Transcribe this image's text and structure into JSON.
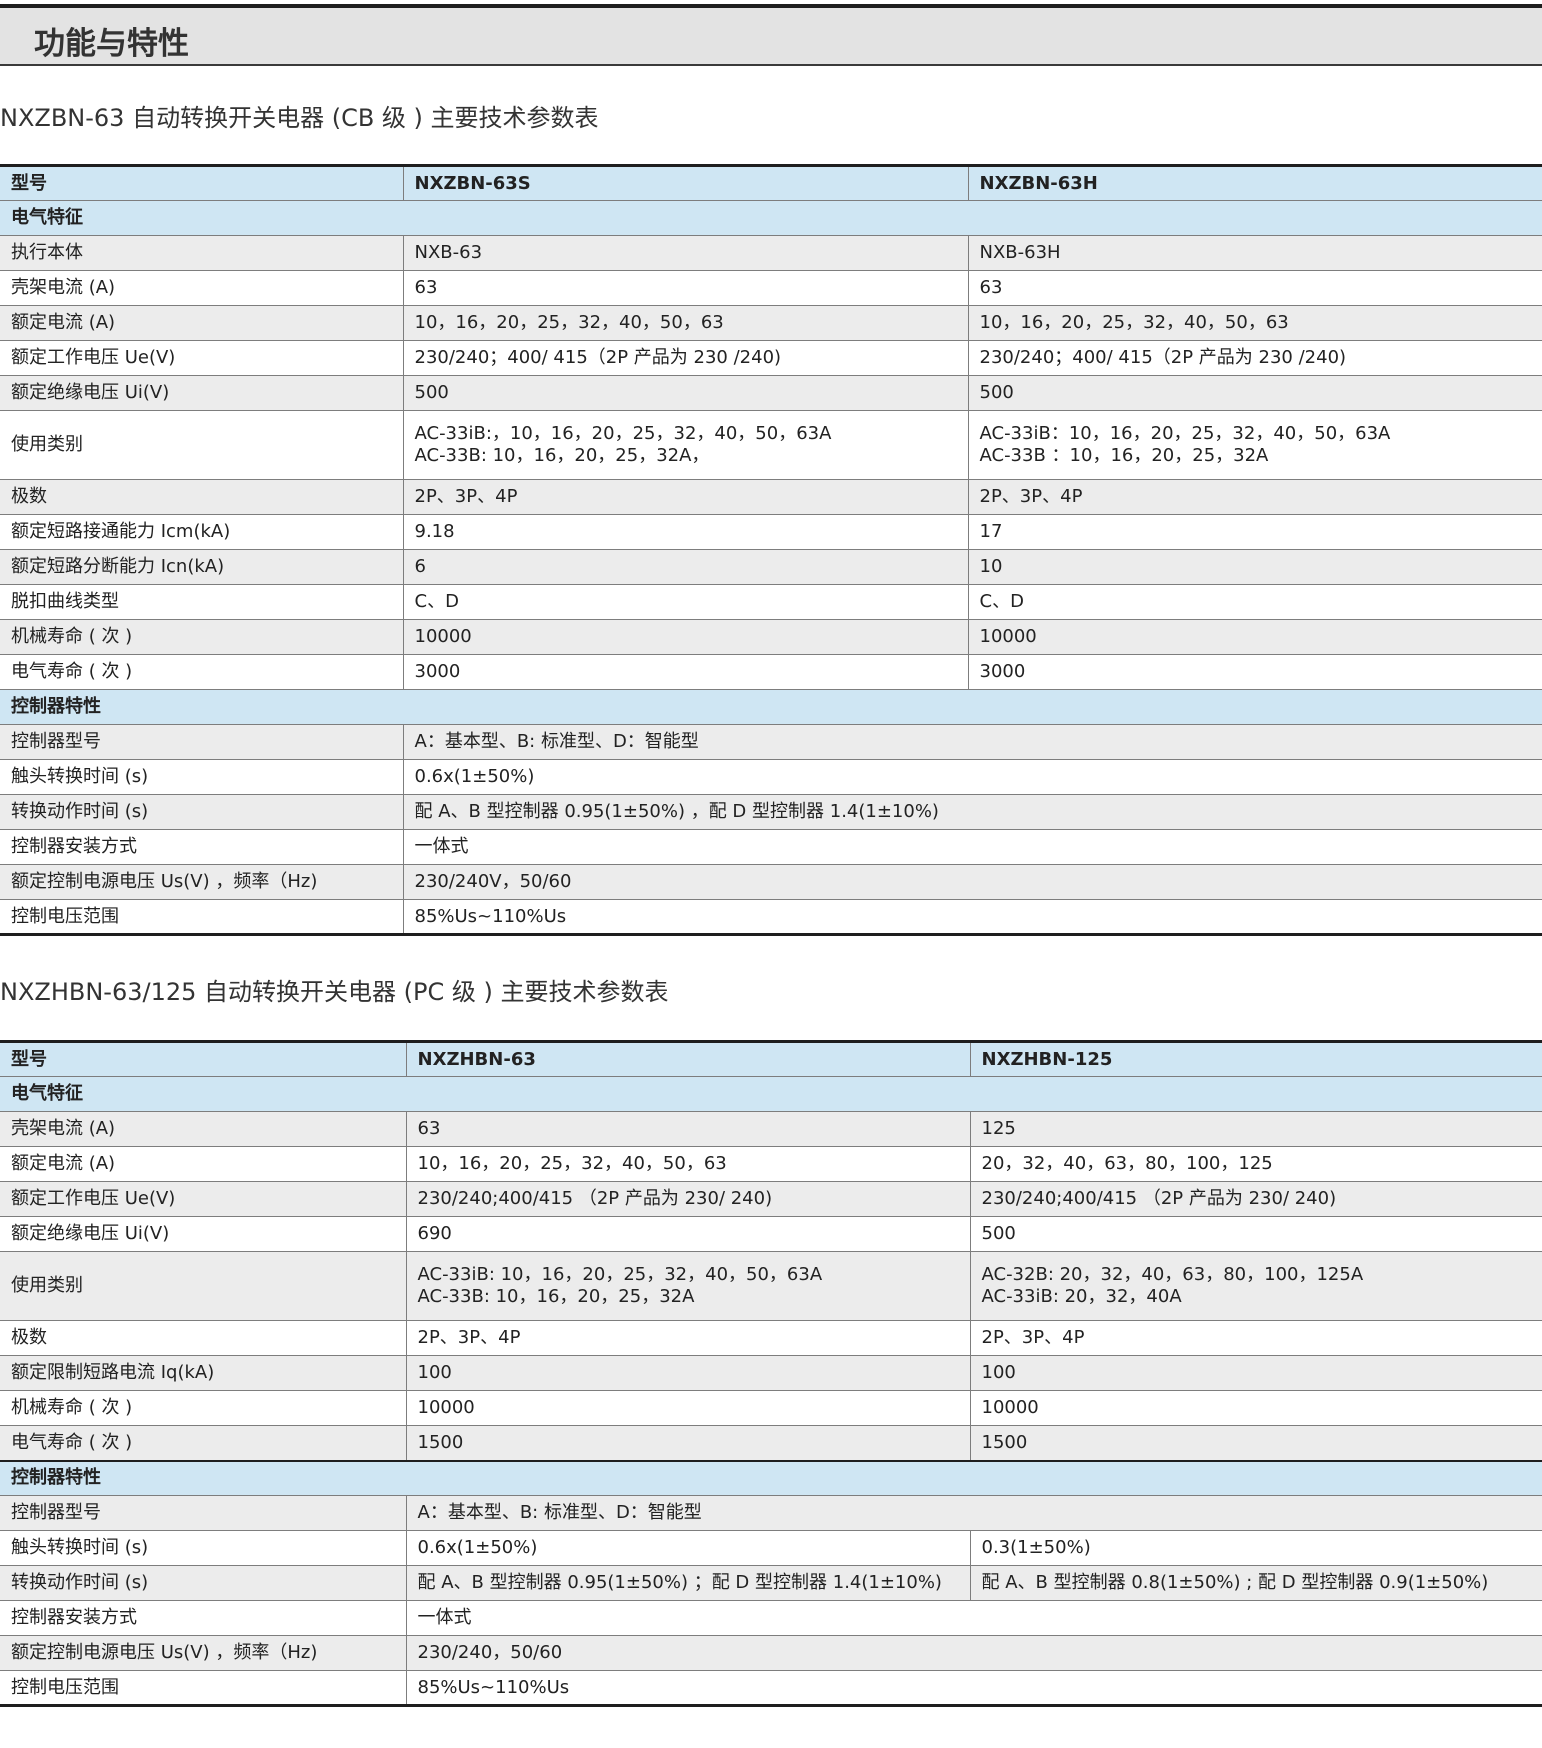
{
  "section_title": "功能与特性",
  "tables": [
    {
      "title": "NXZBN-63 自动转换开关电器 (CB 级 ) 主要技术参数表",
      "header": [
        "型号",
        "NXZBN-63S",
        "NXZBN-63H"
      ],
      "electrical_label": "电气特征",
      "electrical_rows": [
        {
          "label": "执行本体",
          "values": [
            "NXB-63",
            "NXB-63H"
          ]
        },
        {
          "label": "壳架电流 (A)",
          "values": [
            "63",
            "63"
          ]
        },
        {
          "label": "额定电流 (A)",
          "values": [
            "10，16，20，25，32，40，50，63",
            "10，16，20，25，32，40，50，63"
          ]
        },
        {
          "label": "额定工作电压 Ue(V)",
          "values": [
            "230/240；400/ 415（2P 产品为 230 /240)",
            "230/240；400/ 415（2P 产品为 230 /240)"
          ]
        },
        {
          "label": "额定绝缘电压 Ui(V)",
          "values": [
            "500",
            "500"
          ]
        },
        {
          "label": "使用类别",
          "values": [
            [
              "AC-33iB:，10，16，20，25，32，40，50，63A",
              "AC-33B: 10，16，20，25，32A，"
            ],
            [
              "AC-33iB：10，16，20，25，32，40，50，63A",
              "AC-33B ：10，16，20，25，32A"
            ]
          ]
        },
        {
          "label": "极数",
          "values": [
            "2P、3P、4P",
            "2P、3P、4P"
          ]
        },
        {
          "label": "额定短路接通能力 Icm(kA)",
          "values": [
            "9.18",
            "17"
          ]
        },
        {
          "label": "额定短路分断能力 Icn(kA)",
          "values": [
            "6",
            "10"
          ]
        },
        {
          "label": "脱扣曲线类型",
          "values": [
            "C、D",
            "C、D"
          ]
        },
        {
          "label": "机械寿命 ( 次 )",
          "values": [
            "10000",
            "10000"
          ]
        },
        {
          "label": "电气寿命 ( 次 )",
          "values": [
            "3000",
            "3000"
          ]
        }
      ],
      "controller_label": "控制器特性",
      "controller_rows": [
        {
          "label": "控制器型号",
          "value": "A：基本型、B: 标准型、D：智能型"
        },
        {
          "label": "触头转换时间 (s)",
          "value": "0.6x(1±50%)"
        },
        {
          "label": "转换动作时间 (s)",
          "value": "配 A、B 型控制器 0.95(1±50%) ，配 D 型控制器 1.4(1±10%)"
        },
        {
          "label": "控制器安装方式",
          "value": "一体式"
        },
        {
          "label": "额定控制电源电压 Us(V) ，频率（Hz)",
          "value": " 230/240V，50/60"
        },
        {
          "label": "控制电压范围",
          "value": "85%Us~110%Us"
        }
      ]
    },
    {
      "title": "NXZHBN-63/125 自动转换开关电器 (PC 级 ) 主要技术参数表",
      "header": [
        "型号",
        "NXZHBN-63",
        "NXZHBN-125"
      ],
      "electrical_label": "电气特征",
      "electrical_rows": [
        {
          "label": "壳架电流 (A)",
          "values": [
            "63",
            "125"
          ]
        },
        {
          "label": "额定电流 (A)",
          "values": [
            "10，16，20，25，32，40，50，63",
            "20，32，40，63，80，100，125"
          ]
        },
        {
          "label": "额定工作电压 Ue(V)",
          "values": [
            "230/240;400/415 （2P 产品为 230/ 240)",
            "230/240;400/415 （2P 产品为 230/ 240)"
          ]
        },
        {
          "label": "额定绝缘电压 Ui(V)",
          "values": [
            "690",
            "500"
          ]
        },
        {
          "label": "使用类别",
          "values": [
            [
              "AC-33iB: 10，16，20，25，32，40，50，63A",
              "AC-33B: 10，16，20，25，32A"
            ],
            [
              "AC-32B: 20，32，40，63，80，100，125A",
              "AC-33iB: 20，32，40A"
            ]
          ]
        },
        {
          "label": "极数",
          "values": [
            "2P、3P、4P",
            "2P、3P、4P"
          ]
        },
        {
          "label": "额定限制短路电流 Iq(kA)",
          "values": [
            "100",
            "100"
          ]
        },
        {
          "label": "机械寿命 ( 次 )",
          "values": [
            "10000",
            "10000"
          ]
        },
        {
          "label": "电气寿命 ( 次 )",
          "values": [
            "1500",
            "1500"
          ]
        }
      ],
      "controller_label": "控制器特性",
      "controller_rows": [
        {
          "label": "控制器型号",
          "value": "A：基本型、B: 标准型、D：智能型"
        },
        {
          "label": "触头转换时间 (s)",
          "values": [
            "0.6x(1±50%)",
            "0.3(1±50%)"
          ]
        },
        {
          "label": "转换动作时间 (s)",
          "values": [
            "配 A、B 型控制器 0.95(1±50%) ；配 D 型控制器 1.4(1±10%)",
            "配 A、B 型控制器 0.8(1±50%) ; 配 D 型控制器 0.9(1±50%)"
          ]
        },
        {
          "label": "控制器安装方式",
          "value": "一体式"
        },
        {
          "label": "额定控制电源电压 Us(V) ，频率（Hz)",
          "value": "230/240，50/60"
        },
        {
          "label": "控制电压范围",
          "value": "85%Us~110%Us"
        }
      ]
    }
  ]
}
